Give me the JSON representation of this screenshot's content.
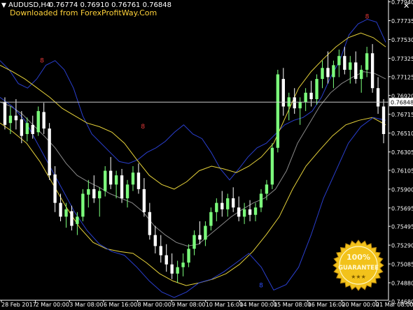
{
  "header": {
    "symbol_label": "AUDUSD,H4",
    "ohlc": "0.76774 0.76910 0.76761 0.76848",
    "watermark": "Downloaded from ForexProfitWay.Com",
    "close_glyph": "✕"
  },
  "badge": {
    "line1": "100%",
    "line2": "GUARANTEE",
    "stars": "★★★"
  },
  "colors": {
    "background": "#000000",
    "axis": "#ffffff",
    "bull_candle": "#7cff7c",
    "bear_candle": "#ffffff",
    "upper_band": "#2a3fcf",
    "mid_band": "#8a8a8a",
    "yellow_band": "#e6d23a",
    "signal_down": "#e83a3a",
    "signal_up": "#2f4fff",
    "current_price_line": "#c8c8c8",
    "badge_gold": "#f2c21b"
  },
  "chart_data": {
    "type": "candlestick",
    "instrument": "AUDUSD",
    "timeframe": "H4",
    "current_price": 0.76848,
    "current_price_label": "0.76848",
    "ylim": [
      0.7469,
      0.7796
    ],
    "y_ticks": [
      "0.77940",
      "0.77735",
      "0.77530",
      "0.77325",
      "0.77125",
      "0.76920",
      "0.76715",
      "0.76510",
      "0.76305",
      "0.76105",
      "0.75900",
      "0.75695",
      "0.75495",
      "0.75290",
      "0.75085",
      "0.74880",
      "0.74680"
    ],
    "x_labels": [
      "28 Feb 2017",
      "2 Mar 00:00",
      "3 Mar 08:00",
      "6 Mar 16:00",
      "8 Mar 00:00",
      "9 Mar 08:00",
      "10 Mar 16:00",
      "14 Mar 00:00",
      "15 Mar 08:00",
      "16 Mar 16:00",
      "20 Mar 00:00",
      "21 Mar 08:00"
    ],
    "candles": [
      [
        0.7685,
        0.769,
        0.7655,
        0.766
      ],
      [
        0.7662,
        0.768,
        0.765,
        0.767
      ],
      [
        0.767,
        0.7688,
        0.7655,
        0.7665
      ],
      [
        0.7666,
        0.7675,
        0.764,
        0.7648
      ],
      [
        0.765,
        0.7668,
        0.7642,
        0.7662
      ],
      [
        0.766,
        0.767,
        0.7645,
        0.765
      ],
      [
        0.7652,
        0.768,
        0.7648,
        0.7675
      ],
      [
        0.7674,
        0.7684,
        0.765,
        0.7656
      ],
      [
        0.7656,
        0.7662,
        0.76,
        0.7605
      ],
      [
        0.7606,
        0.7615,
        0.7565,
        0.7575
      ],
      [
        0.7575,
        0.7585,
        0.7555,
        0.756
      ],
      [
        0.756,
        0.7575,
        0.7548,
        0.7568
      ],
      [
        0.7566,
        0.7572,
        0.7545,
        0.755
      ],
      [
        0.7552,
        0.7565,
        0.754,
        0.756
      ],
      [
        0.756,
        0.759,
        0.7555,
        0.7585
      ],
      [
        0.7584,
        0.76,
        0.757,
        0.759
      ],
      [
        0.759,
        0.7605,
        0.7575,
        0.758
      ],
      [
        0.758,
        0.7592,
        0.756,
        0.7588
      ],
      [
        0.7588,
        0.7615,
        0.7582,
        0.761
      ],
      [
        0.761,
        0.7625,
        0.759,
        0.7595
      ],
      [
        0.7595,
        0.761,
        0.758,
        0.7605
      ],
      [
        0.7605,
        0.7612,
        0.7575,
        0.758
      ],
      [
        0.758,
        0.76,
        0.757,
        0.7595
      ],
      [
        0.7595,
        0.7615,
        0.7588,
        0.7608
      ],
      [
        0.7608,
        0.7618,
        0.7585,
        0.759
      ],
      [
        0.759,
        0.7602,
        0.756,
        0.7565
      ],
      [
        0.7565,
        0.7575,
        0.7535,
        0.754
      ],
      [
        0.754,
        0.755,
        0.752,
        0.7528
      ],
      [
        0.7528,
        0.754,
        0.751,
        0.7518
      ],
      [
        0.7518,
        0.753,
        0.75,
        0.7508
      ],
      [
        0.7508,
        0.752,
        0.7492,
        0.7498
      ],
      [
        0.7498,
        0.7512,
        0.7488,
        0.7505
      ],
      [
        0.7505,
        0.752,
        0.7495,
        0.751
      ],
      [
        0.751,
        0.753,
        0.7505,
        0.7525
      ],
      [
        0.7525,
        0.7545,
        0.7518,
        0.754
      ],
      [
        0.754,
        0.7555,
        0.753,
        0.7535
      ],
      [
        0.7535,
        0.7555,
        0.7528,
        0.755
      ],
      [
        0.755,
        0.757,
        0.7545,
        0.7565
      ],
      [
        0.7565,
        0.758,
        0.7555,
        0.7575
      ],
      [
        0.7575,
        0.7588,
        0.756,
        0.7568
      ],
      [
        0.7568,
        0.7585,
        0.756,
        0.758
      ],
      [
        0.758,
        0.7592,
        0.7565,
        0.757
      ],
      [
        0.757,
        0.7582,
        0.7555,
        0.756
      ],
      [
        0.756,
        0.7575,
        0.7552,
        0.7568
      ],
      [
        0.7568,
        0.7578,
        0.7555,
        0.7562
      ],
      [
        0.7562,
        0.7575,
        0.7555,
        0.757
      ],
      [
        0.757,
        0.759,
        0.7565,
        0.7585
      ],
      [
        0.7585,
        0.76,
        0.7578,
        0.7595
      ],
      [
        0.7595,
        0.764,
        0.759,
        0.7635
      ],
      [
        0.7635,
        0.772,
        0.763,
        0.7715
      ],
      [
        0.771,
        0.7722,
        0.767,
        0.768
      ],
      [
        0.768,
        0.7695,
        0.7665,
        0.769
      ],
      [
        0.769,
        0.77,
        0.7672,
        0.7678
      ],
      [
        0.7678,
        0.769,
        0.766,
        0.7685
      ],
      [
        0.7685,
        0.77,
        0.7675,
        0.7695
      ],
      [
        0.7695,
        0.7708,
        0.768,
        0.7688
      ],
      [
        0.7688,
        0.7715,
        0.7682,
        0.771
      ],
      [
        0.771,
        0.773,
        0.77,
        0.7722
      ],
      [
        0.7722,
        0.774,
        0.7705,
        0.7712
      ],
      [
        0.7712,
        0.773,
        0.77,
        0.7725
      ],
      [
        0.7725,
        0.7742,
        0.7712,
        0.7735
      ],
      [
        0.7735,
        0.7745,
        0.7715,
        0.772
      ],
      [
        0.772,
        0.7735,
        0.7705,
        0.7728
      ],
      [
        0.7728,
        0.774,
        0.7705,
        0.771
      ],
      [
        0.771,
        0.7725,
        0.7695,
        0.772
      ],
      [
        0.772,
        0.7745,
        0.7712,
        0.7738
      ],
      [
        0.7738,
        0.7748,
        0.7695,
        0.77
      ],
      [
        0.77,
        0.7712,
        0.7672,
        0.768
      ],
      [
        0.768,
        0.7688,
        0.764,
        0.765
      ]
    ],
    "bands": {
      "upper": [
        0.773,
        0.772,
        0.7705,
        0.77,
        0.771,
        0.7725,
        0.773,
        0.772,
        0.77,
        0.767,
        0.765,
        0.764,
        0.763,
        0.762,
        0.7618,
        0.7622,
        0.763,
        0.7635,
        0.7642,
        0.7652,
        0.766,
        0.765,
        0.7645,
        0.763,
        0.7612,
        0.76,
        0.7612,
        0.7625,
        0.7635,
        0.764,
        0.765,
        0.766,
        0.7665,
        0.7668,
        0.7675,
        0.769,
        0.7712,
        0.773,
        0.7758,
        0.777,
        0.7775,
        0.7772,
        0.775
      ],
      "middle": [
        0.7685,
        0.768,
        0.7672,
        0.766,
        0.7648,
        0.7635,
        0.7618,
        0.7605,
        0.7598,
        0.7592,
        0.7585,
        0.758,
        0.7575,
        0.7565,
        0.755,
        0.754,
        0.7532,
        0.7528,
        0.753,
        0.754,
        0.755,
        0.756,
        0.7568,
        0.7575,
        0.758,
        0.759,
        0.761,
        0.764,
        0.766,
        0.768,
        0.7695,
        0.7705,
        0.7712,
        0.7718,
        0.7716,
        0.771
      ],
      "yellow_upper": [
        0.7725,
        0.7718,
        0.771,
        0.77,
        0.769,
        0.7678,
        0.767,
        0.7662,
        0.7658,
        0.7652,
        0.764,
        0.7622,
        0.7605,
        0.7595,
        0.759,
        0.7598,
        0.761,
        0.7615,
        0.7612,
        0.7608,
        0.7615,
        0.7625,
        0.764,
        0.767,
        0.77,
        0.7718,
        0.7732,
        0.7745,
        0.7755,
        0.776,
        0.7755,
        0.7745
      ],
      "yellow_lower": [
        0.7662,
        0.7652,
        0.764,
        0.762,
        0.7595,
        0.757,
        0.7548,
        0.7532,
        0.7525,
        0.7522,
        0.752,
        0.751,
        0.7498,
        0.749,
        0.7485,
        0.7488,
        0.7492,
        0.7498,
        0.7508,
        0.7522,
        0.754,
        0.756,
        0.759,
        0.7615,
        0.7632,
        0.7648,
        0.766,
        0.7665,
        0.7668,
        0.766
      ],
      "lower": [
        0.769,
        0.768,
        0.7665,
        0.764,
        0.7615,
        0.759,
        0.7565,
        0.7545,
        0.753,
        0.7522,
        0.7518,
        0.7505,
        0.749,
        0.7478,
        0.7472,
        0.7478,
        0.7488,
        0.7492,
        0.75,
        0.751,
        0.752,
        0.7505,
        0.748,
        0.7486,
        0.7505,
        0.754,
        0.758,
        0.761,
        0.764,
        0.7658,
        0.7668,
        0.7665
      ]
    },
    "signals": [
      {
        "type": "sell",
        "label": "8",
        "x": 0.108,
        "price": 0.7728
      },
      {
        "type": "sell",
        "label": "8",
        "x": 0.368,
        "price": 0.7656
      },
      {
        "type": "buy",
        "label": "8",
        "x": 0.672,
        "price": 0.7483
      },
      {
        "type": "sell",
        "label": "8",
        "x": 0.945,
        "price": 0.7776
      }
    ]
  }
}
